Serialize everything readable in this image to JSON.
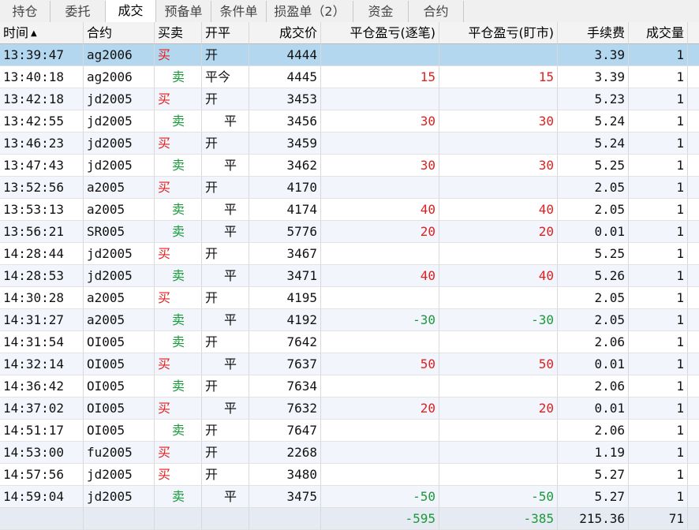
{
  "tabs": [
    {
      "label": "持仓",
      "active": false
    },
    {
      "label": "委托",
      "active": false
    },
    {
      "label": "成交",
      "active": true
    },
    {
      "label": "预备单",
      "active": false
    },
    {
      "label": "条件单",
      "active": false
    },
    {
      "label": "损盈单（2）",
      "active": false
    },
    {
      "label": "资金",
      "active": false
    },
    {
      "label": "合约",
      "active": false
    }
  ],
  "headers": [
    "时间",
    "合约",
    "买卖",
    "开平",
    "成交价",
    "平仓盈亏(逐笔)",
    "平仓盈亏(盯市)",
    "手续费",
    "成交量"
  ],
  "sort_icon": "▲",
  "rows": [
    {
      "time": "13:39:47",
      "contract": "ag2006",
      "side": "买",
      "oc": "开",
      "price": "4444",
      "pnl_trade": "",
      "pnl_mtm": "",
      "fee": "3.39",
      "qty": "1",
      "selected": true
    },
    {
      "time": "13:40:18",
      "contract": "ag2006",
      "side": "卖",
      "oc": "平今",
      "price": "4445",
      "pnl_trade": "15",
      "pnl_mtm": "15",
      "fee": "3.39",
      "qty": "1"
    },
    {
      "time": "13:42:18",
      "contract": "jd2005",
      "side": "买",
      "oc": "开",
      "price": "3453",
      "pnl_trade": "",
      "pnl_mtm": "",
      "fee": "5.23",
      "qty": "1"
    },
    {
      "time": "13:42:55",
      "contract": "jd2005",
      "side": "卖",
      "oc": "平",
      "price": "3456",
      "pnl_trade": "30",
      "pnl_mtm": "30",
      "fee": "5.24",
      "qty": "1"
    },
    {
      "time": "13:46:23",
      "contract": "jd2005",
      "side": "买",
      "oc": "开",
      "price": "3459",
      "pnl_trade": "",
      "pnl_mtm": "",
      "fee": "5.24",
      "qty": "1"
    },
    {
      "time": "13:47:43",
      "contract": "jd2005",
      "side": "卖",
      "oc": "平",
      "price": "3462",
      "pnl_trade": "30",
      "pnl_mtm": "30",
      "fee": "5.25",
      "qty": "1"
    },
    {
      "time": "13:52:56",
      "contract": "a2005",
      "side": "买",
      "oc": "开",
      "price": "4170",
      "pnl_trade": "",
      "pnl_mtm": "",
      "fee": "2.05",
      "qty": "1"
    },
    {
      "time": "13:53:13",
      "contract": "a2005",
      "side": "卖",
      "oc": "平",
      "price": "4174",
      "pnl_trade": "40",
      "pnl_mtm": "40",
      "fee": "2.05",
      "qty": "1"
    },
    {
      "time": "13:56:21",
      "contract": "SR005",
      "side": "卖",
      "oc": "平",
      "price": "5776",
      "pnl_trade": "20",
      "pnl_mtm": "20",
      "fee": "0.01",
      "qty": "1"
    },
    {
      "time": "14:28:44",
      "contract": "jd2005",
      "side": "买",
      "oc": "开",
      "price": "3467",
      "pnl_trade": "",
      "pnl_mtm": "",
      "fee": "5.25",
      "qty": "1"
    },
    {
      "time": "14:28:53",
      "contract": "jd2005",
      "side": "卖",
      "oc": "平",
      "price": "3471",
      "pnl_trade": "40",
      "pnl_mtm": "40",
      "fee": "5.26",
      "qty": "1"
    },
    {
      "time": "14:30:28",
      "contract": "a2005",
      "side": "买",
      "oc": "开",
      "price": "4195",
      "pnl_trade": "",
      "pnl_mtm": "",
      "fee": "2.05",
      "qty": "1"
    },
    {
      "time": "14:31:27",
      "contract": "a2005",
      "side": "卖",
      "oc": "平",
      "price": "4192",
      "pnl_trade": "-30",
      "pnl_mtm": "-30",
      "fee": "2.05",
      "qty": "1"
    },
    {
      "time": "14:31:54",
      "contract": "OI005",
      "side": "卖",
      "oc": "开",
      "price": "7642",
      "pnl_trade": "",
      "pnl_mtm": "",
      "fee": "2.06",
      "qty": "1"
    },
    {
      "time": "14:32:14",
      "contract": "OI005",
      "side": "买",
      "oc": "平",
      "price": "7637",
      "pnl_trade": "50",
      "pnl_mtm": "50",
      "fee": "0.01",
      "qty": "1"
    },
    {
      "time": "14:36:42",
      "contract": "OI005",
      "side": "卖",
      "oc": "开",
      "price": "7634",
      "pnl_trade": "",
      "pnl_mtm": "",
      "fee": "2.06",
      "qty": "1"
    },
    {
      "time": "14:37:02",
      "contract": "OI005",
      "side": "买",
      "oc": "平",
      "price": "7632",
      "pnl_trade": "20",
      "pnl_mtm": "20",
      "fee": "0.01",
      "qty": "1"
    },
    {
      "time": "14:51:17",
      "contract": "OI005",
      "side": "卖",
      "oc": "开",
      "price": "7647",
      "pnl_trade": "",
      "pnl_mtm": "",
      "fee": "2.06",
      "qty": "1"
    },
    {
      "time": "14:53:00",
      "contract": "fu2005",
      "side": "买",
      "oc": "开",
      "price": "2268",
      "pnl_trade": "",
      "pnl_mtm": "",
      "fee": "1.19",
      "qty": "1"
    },
    {
      "time": "14:57:56",
      "contract": "jd2005",
      "side": "买",
      "oc": "开",
      "price": "3480",
      "pnl_trade": "",
      "pnl_mtm": "",
      "fee": "5.27",
      "qty": "1"
    },
    {
      "time": "14:59:04",
      "contract": "jd2005",
      "side": "卖",
      "oc": "平",
      "price": "3475",
      "pnl_trade": "-50",
      "pnl_mtm": "-50",
      "fee": "5.27",
      "qty": "1"
    }
  ],
  "totals": {
    "pnl_trade": "-595",
    "pnl_mtm": "-385",
    "fee": "215.36",
    "qty": "71"
  },
  "colors": {
    "buy": "#e02020",
    "sell": "#1a9a3a",
    "selected": "#b3d7ef"
  }
}
